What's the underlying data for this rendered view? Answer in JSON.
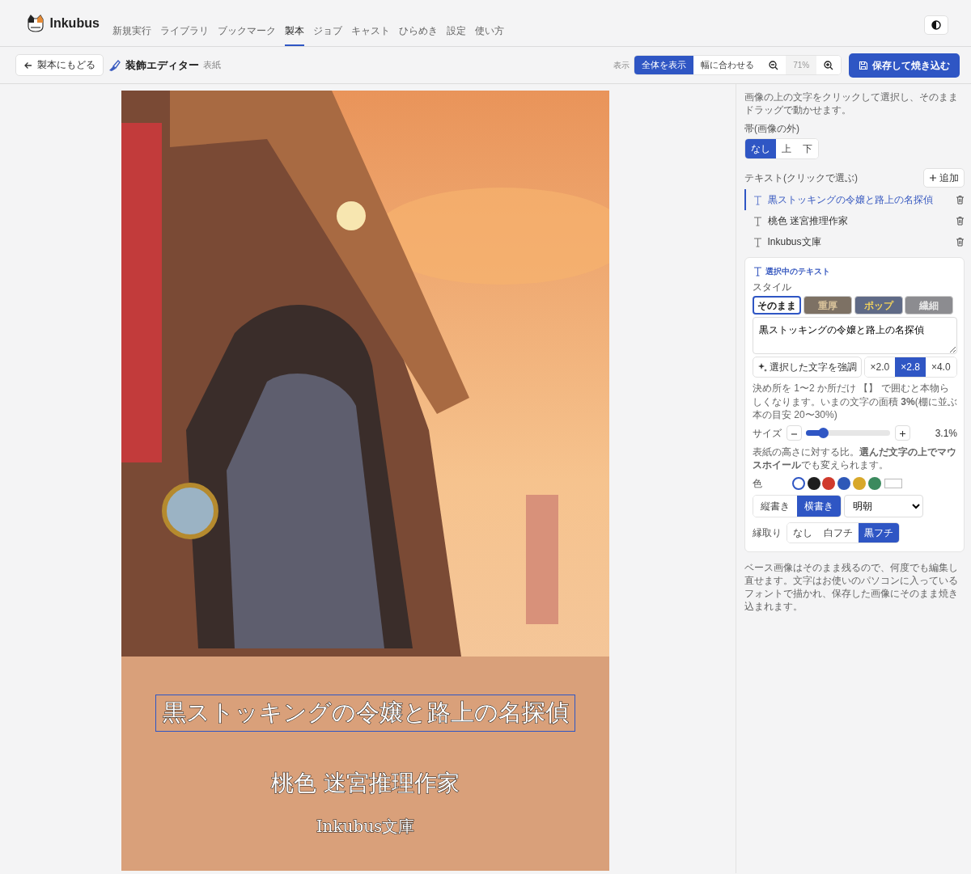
{
  "app": {
    "name": "Inkubus"
  },
  "nav": [
    {
      "label": "新規実行",
      "selected": false
    },
    {
      "label": "ライブラリ",
      "selected": false
    },
    {
      "label": "ブックマーク",
      "selected": false
    },
    {
      "label": "製本",
      "selected": true
    },
    {
      "label": "ジョブ",
      "selected": false
    },
    {
      "label": "キャスト",
      "selected": false
    },
    {
      "label": "ひらめき",
      "selected": false
    },
    {
      "label": "設定",
      "selected": false
    },
    {
      "label": "使い方",
      "selected": false
    }
  ],
  "toolbar": {
    "back_button": "製本にもどる",
    "title": "装飾エディター",
    "subtitle": "表紙",
    "view_label": "表示",
    "view_modes": [
      {
        "label": "全体を表示",
        "selected": true
      },
      {
        "label": "幅に合わせる",
        "selected": false
      }
    ],
    "zoom": "71%",
    "save_button": "保存して焼き込む"
  },
  "cover": {
    "kind": "picture",
    "texts": [
      {
        "kind": "title",
        "text": "黒ストッキングの令嬢と路上の名探偵",
        "selected": true
      },
      {
        "kind": "author",
        "text": "桃色 迷宮推理作家",
        "selected": false
      },
      {
        "kind": "publisher",
        "text": "Inkubus文庫",
        "selected": false
      }
    ]
  },
  "panel": {
    "hint": "画像の上の文字をクリックして選択し、そのままドラッグで動かせます。",
    "band_label": "帯(画像の外)",
    "band_options": [
      {
        "label": "なし",
        "selected": true
      },
      {
        "label": "上",
        "selected": false
      },
      {
        "label": "下",
        "selected": false
      }
    ],
    "texts_label": "テキスト(クリックで選ぶ)",
    "add_button": "追加",
    "text_items": [
      {
        "label": "黒ストッキングの令嬢と路上の名探偵",
        "selected": true
      },
      {
        "label": "桃色 迷宮推理作家",
        "selected": false
      },
      {
        "label": "Inkubus文庫",
        "selected": false
      }
    ],
    "selected_text": {
      "heading": "選択中のテキスト",
      "style_label": "スタイル",
      "styles": [
        {
          "label": "そのまま",
          "kind": "plain",
          "selected": true
        },
        {
          "label": "重厚",
          "kind": "heavy",
          "selected": false
        },
        {
          "label": "ポップ",
          "kind": "pop",
          "selected": false
        },
        {
          "label": "繊細",
          "kind": "delicate",
          "selected": false
        }
      ],
      "value": "黒ストッキングの令嬢と路上の名探偵",
      "emphasize_button": "選択した文字を強調",
      "multipliers": [
        {
          "label": "×2.0",
          "selected": false
        },
        {
          "label": "×2.8",
          "selected": true
        },
        {
          "label": "×4.0",
          "selected": false
        }
      ],
      "emphasis_note": "決め所を 1〜2 か所だけ 【】 で囲むと本物らしくなります。いまの文字の面積 **3%**(棚に並ぶ本の目安 20〜30%)",
      "size_label": "サイズ",
      "size": {
        "level": 0.2,
        "reading": "3.1%"
      },
      "size_note": "表紙の高さに対する比。**選んだ文字の上でマウスホイール**でも変えられます。",
      "color_label": "色",
      "colors": [
        {
          "color": "#ffffff",
          "selected": true
        },
        {
          "color": "#1e1e1e",
          "selected": false
        },
        {
          "color": "#d03a2c",
          "selected": false
        },
        {
          "color": "#2e58b8",
          "selected": false
        },
        {
          "color": "#d8a82a",
          "selected": false
        },
        {
          "color": "#3b8a5e",
          "selected": false
        }
      ],
      "orientations": [
        {
          "label": "縦書き",
          "selected": false
        },
        {
          "label": "横書き",
          "selected": true
        }
      ],
      "font": "明朝",
      "outline_label": "縁取り",
      "outlines": [
        {
          "label": "なし",
          "selected": false
        },
        {
          "label": "白フチ",
          "selected": false
        },
        {
          "label": "黒フチ",
          "selected": true
        }
      ]
    },
    "footer_note": "ベース画像はそのまま残るので、何度でも編集し直せます。文字はお使いのパソコンに入っているフォントで描かれ、保存した画像にそのまま焼き込まれます。"
  }
}
